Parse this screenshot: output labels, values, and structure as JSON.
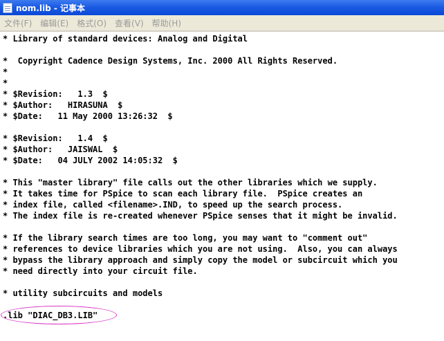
{
  "window": {
    "title": "nom.lib - 记事本",
    "icon": "notepad-icon"
  },
  "menu": {
    "items": [
      "文件(F)",
      "编辑(E)",
      "格式(O)",
      "查看(V)",
      "帮助(H)"
    ]
  },
  "editor": {
    "lines": [
      "* Library of standard devices: Analog and Digital",
      "",
      "*  Copyright Cadence Design Systems, Inc. 2000 All Rights Reserved.",
      "*",
      "*",
      "* $Revision:   1.3  $",
      "* $Author:   HIRASUNA  $",
      "* $Date:   11 May 2000 13:26:32  $",
      "",
      "* $Revision:   1.4  $",
      "* $Author:   JAISWAL  $",
      "* $Date:   04 JULY 2002 14:05:32  $",
      "",
      "* This \"master library\" file calls out the other libraries which we supply.",
      "* It takes time for PSpice to scan each library file.  PSpice creates an",
      "* index file, called <filename>.IND, to speed up the search process.",
      "* The index file is re-created whenever PSpice senses that it might be invalid.",
      "",
      "* If the library search times are too long, you may want to \"comment out\"",
      "* references to device libraries which you are not using.  Also, you can always",
      "* bypass the library approach and simply copy the model or subcircuit which you",
      "* need directly into your circuit file.",
      "",
      "* utility subcircuits and models",
      "",
      ".lib \"DIAC_DB3.LIB\""
    ]
  },
  "annotation": {
    "color": "#d836c8"
  }
}
